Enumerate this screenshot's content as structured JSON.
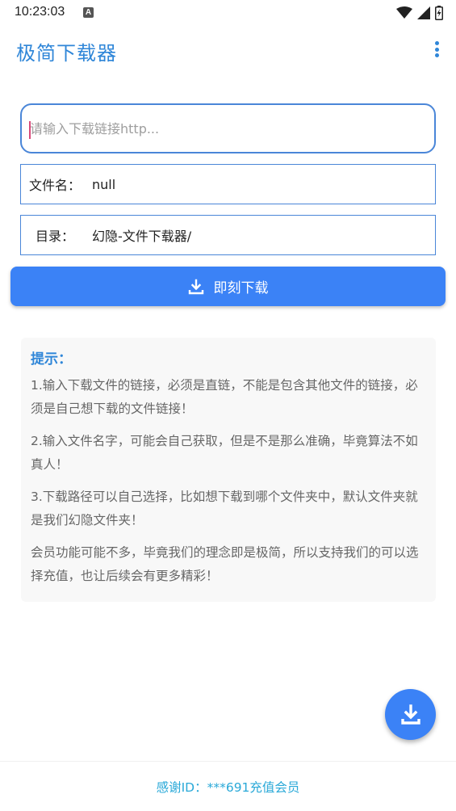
{
  "status_bar": {
    "time": "10:23:03",
    "notification_letter": "A",
    "icons": [
      "wifi-icon",
      "signal-icon",
      "battery-charging-icon"
    ]
  },
  "app_bar": {
    "title": "极简下载器",
    "overflow_icon": "more-vert-icon"
  },
  "form": {
    "url_placeholder": "请输入下载链接http...",
    "url_value": "",
    "filename_label": "文件名：",
    "filename_value": "null",
    "directory_label": "目录：",
    "directory_value": "幻隐-文件下载器/"
  },
  "download_button": {
    "label": "即刻下载",
    "icon": "download-icon"
  },
  "tips": {
    "title": "提示：",
    "items": [
      "1.输入下载文件的链接，必须是直链，不能是包含其他文件的链接，必须是自己想下载的文件链接！",
      "2.输入文件名字，可能会自己获取，但是不是那么准确，毕竟算法不如真人！",
      "3.下载路径可以自己选择，比如想下载到哪个文件夹中，默认文件夹就是我们幻隐文件夹！",
      "会员功能可能不多，毕竟我们的理念即是极简，所以支持我们的可以选择充值，也让后续会有更多精彩！"
    ]
  },
  "fab": {
    "icon": "download-icon"
  },
  "footer": {
    "text": "感谢ID：***691充值会员"
  },
  "colors": {
    "accent": "#2f86d8",
    "button": "#3b82f6",
    "footer_text": "#2aa9d8",
    "border": "#4a86d8"
  }
}
